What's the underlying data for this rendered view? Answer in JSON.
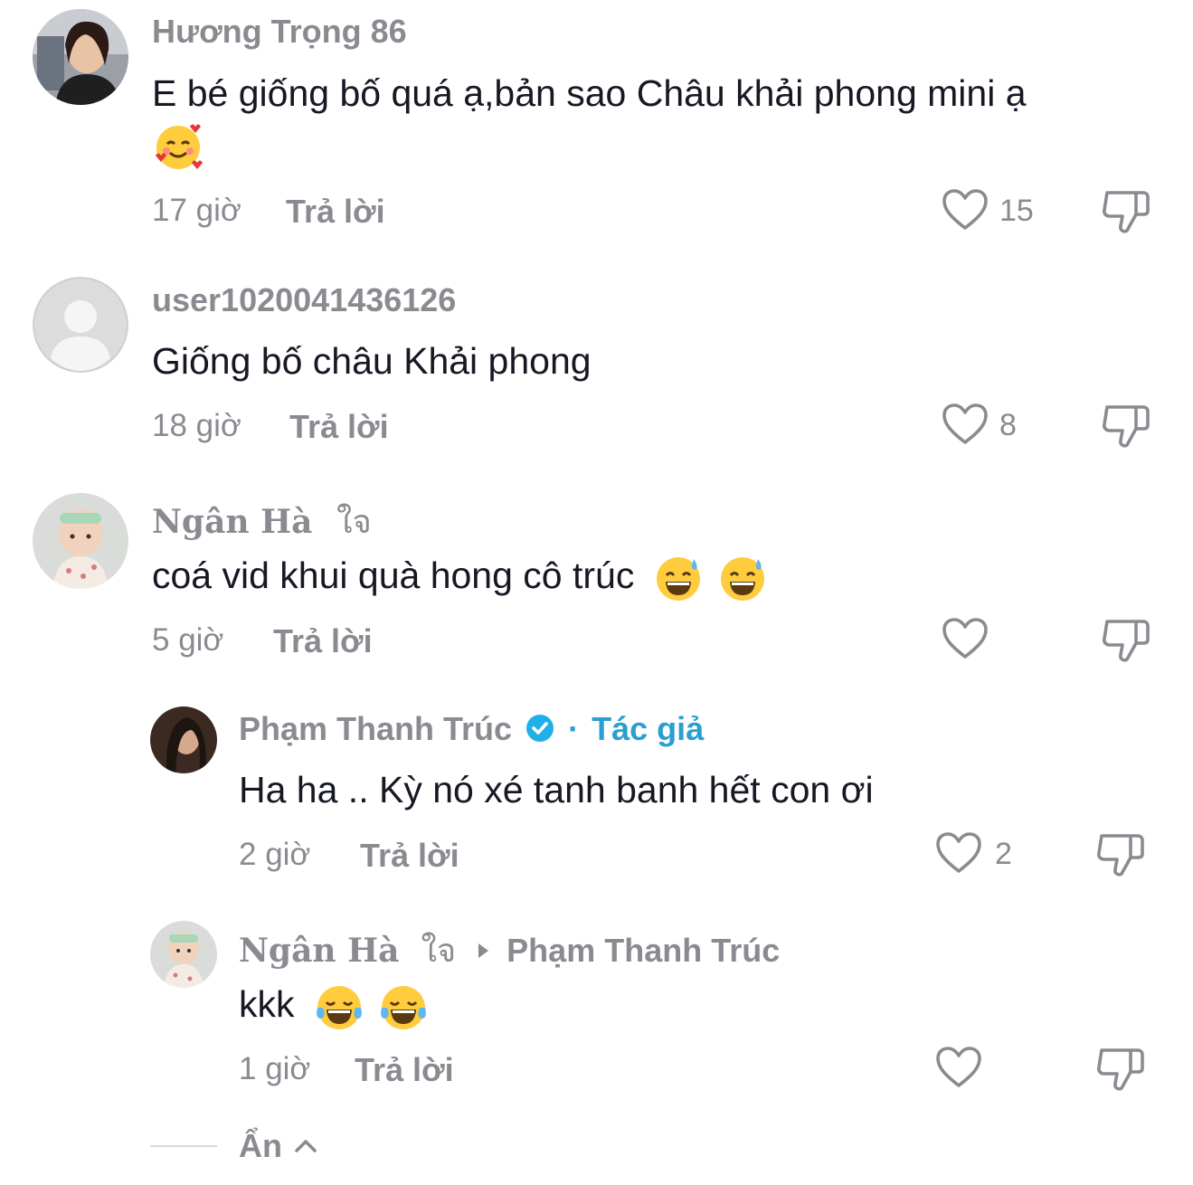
{
  "comments": [
    {
      "username": "Hương Trọng 86",
      "text": "E bé giống bố quá ạ,bản sao Châu khải phong mini ạ",
      "time": "17 giờ",
      "reply_label": "Trả lời",
      "likes": "15"
    },
    {
      "username": "user1020041436126",
      "text": "Giống bố châu Khải phong",
      "time": "18 giờ",
      "reply_label": "Trả lời",
      "likes": "8"
    },
    {
      "username": "Ngân Hà",
      "username_suffix": "ใจ",
      "text": "coá vid khui quà hong cô trúc",
      "time": "5 giờ",
      "reply_label": "Trả lời",
      "likes": ""
    }
  ],
  "replies": [
    {
      "username": "Phạm Thanh Trúc",
      "separator": "·",
      "author_tag": "Tác giả",
      "text": "Ha ha .. Kỳ nó xé tanh banh hết con ơi",
      "time": "2 giờ",
      "reply_label": "Trả lời",
      "likes": "2"
    },
    {
      "username": "Ngân Hà",
      "username_suffix": "ใจ",
      "reply_to": "Phạm Thanh Trúc",
      "text": "kkk",
      "time": "1 giờ",
      "reply_label": "Trả lời",
      "likes": ""
    }
  ],
  "hide_label": "Ẩn",
  "colors": {
    "muted": "#8a8b91",
    "text": "#161823",
    "verified": "#20b0e8",
    "author": "#2a9fd0"
  },
  "icons": [
    "heart-outline-icon",
    "dislike-icon",
    "verified-badge-icon",
    "caret-right-icon",
    "chevron-up-icon"
  ]
}
